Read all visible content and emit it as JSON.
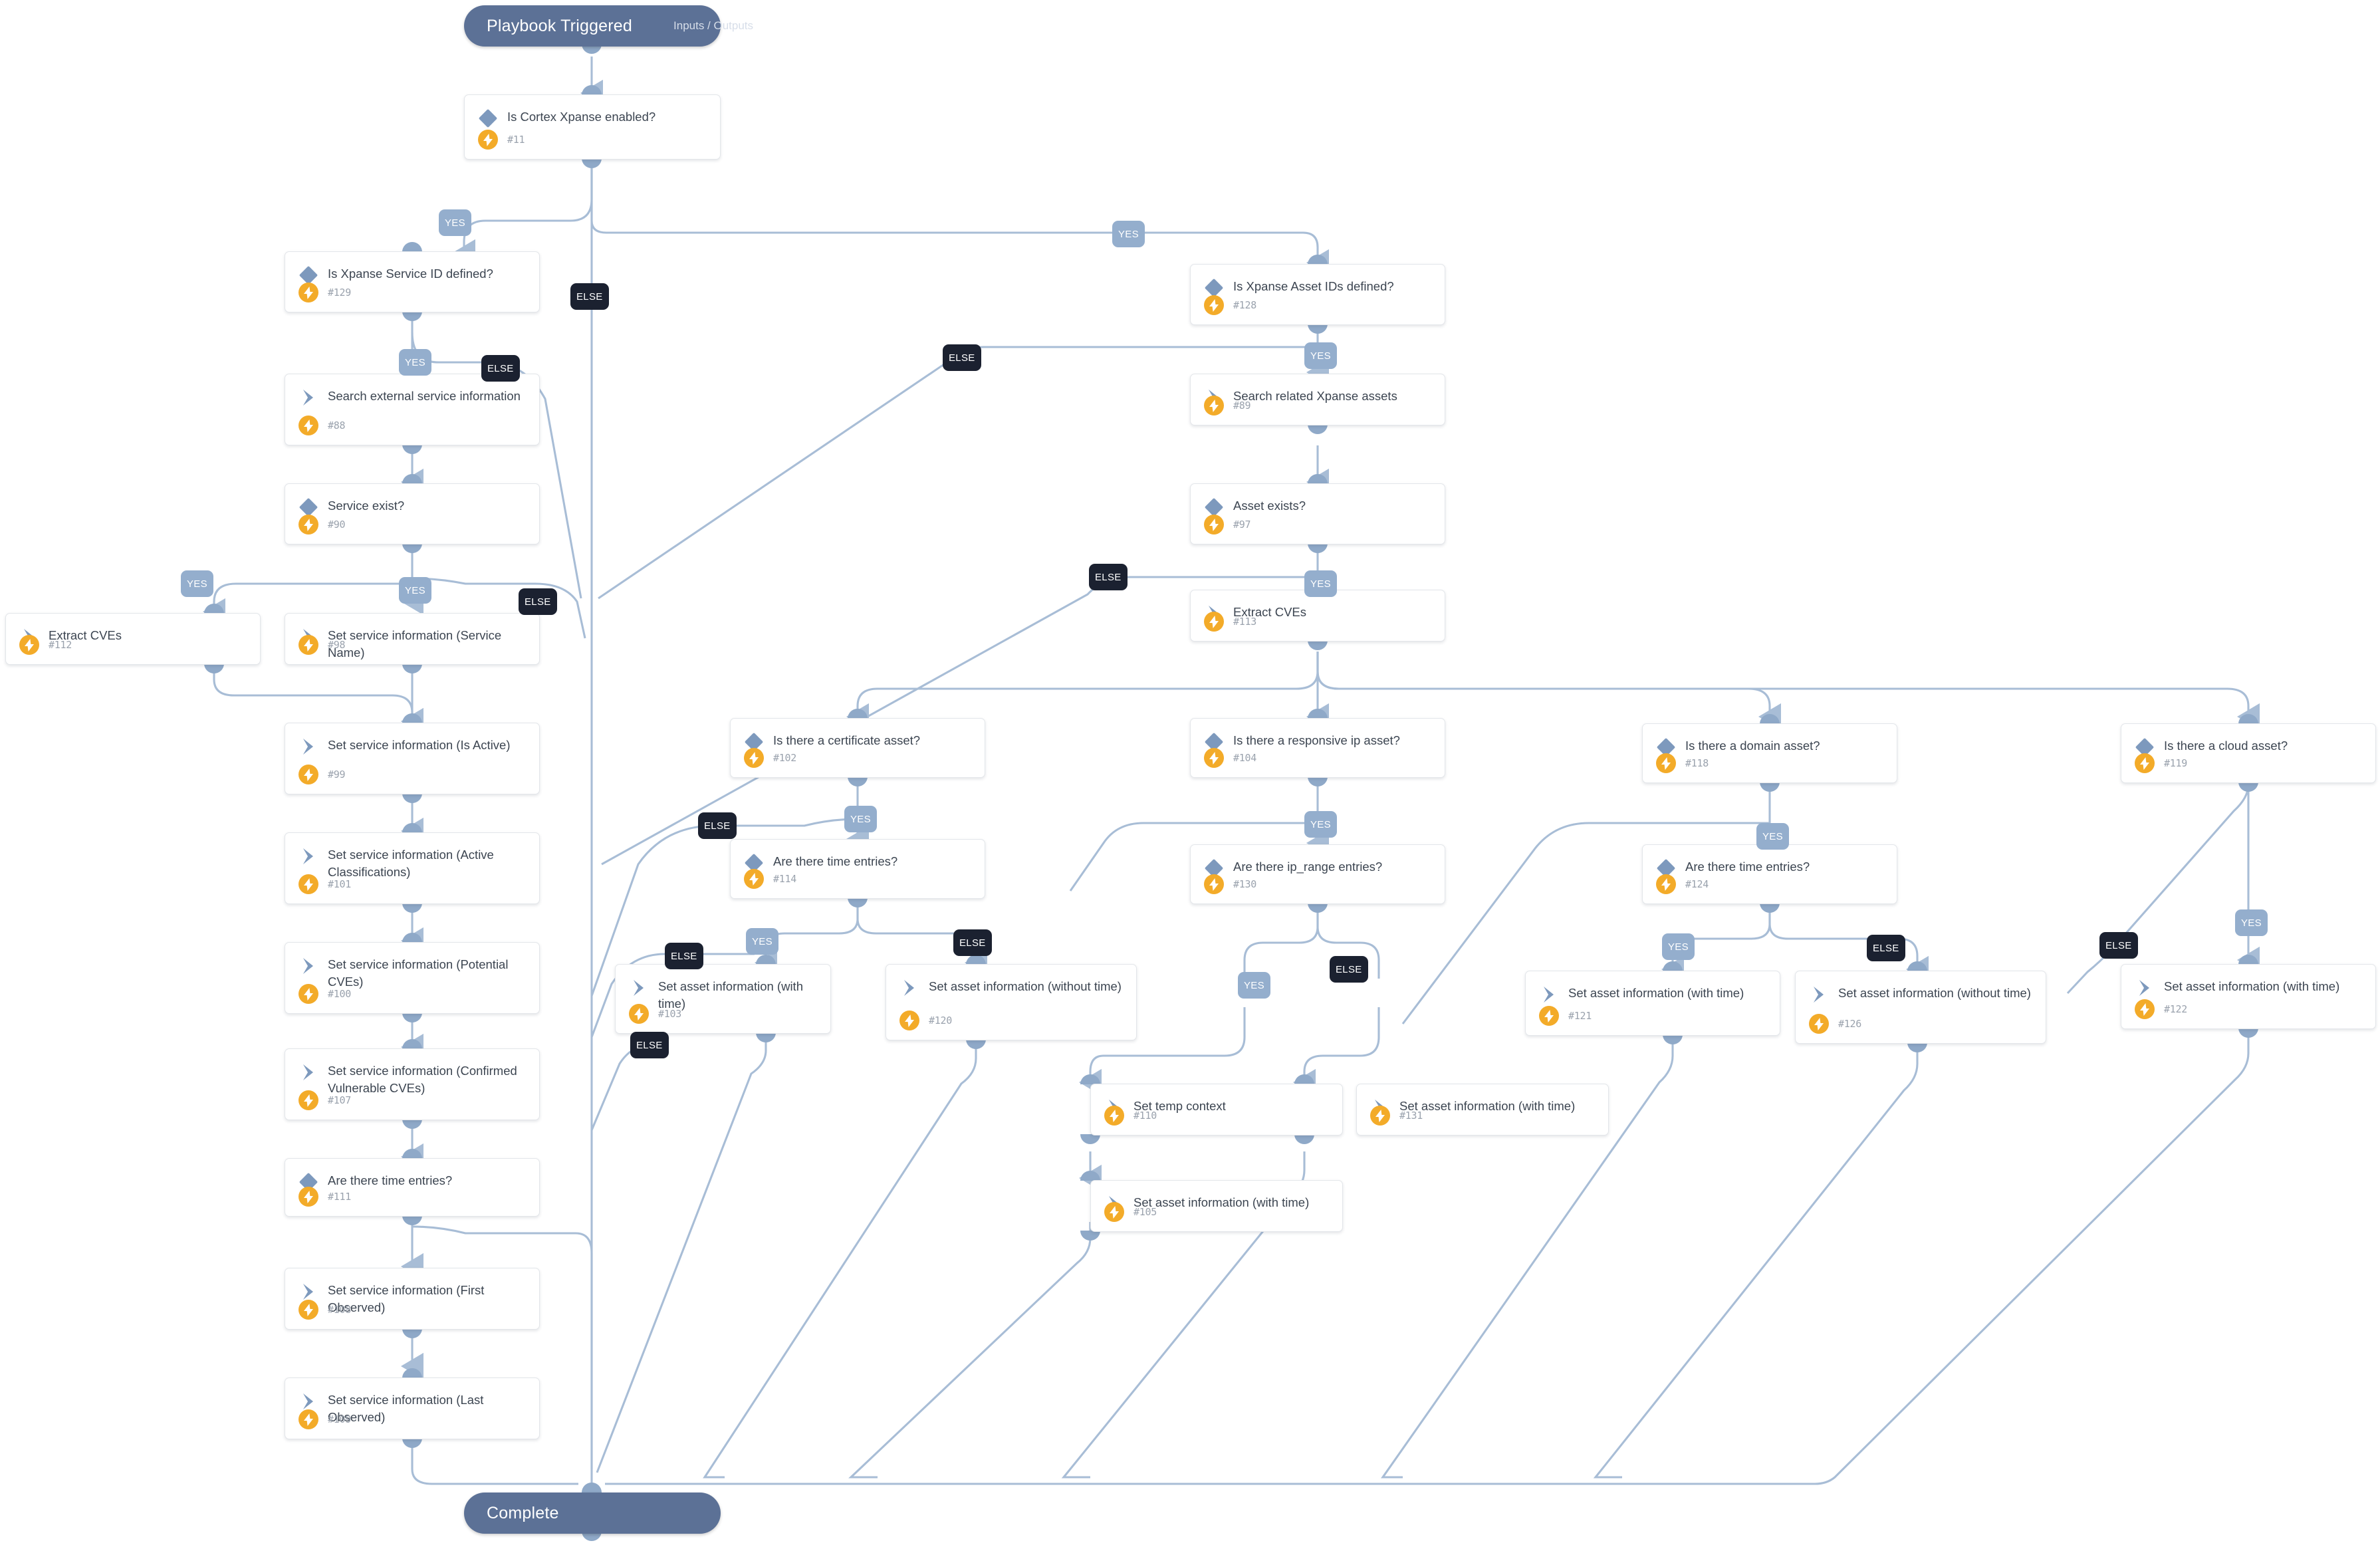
{
  "diagram": {
    "kind": "playbook-flow",
    "start": {
      "label": "Playbook Triggered",
      "sublabel": "Inputs / Outputs"
    },
    "end": {
      "label": "Complete"
    },
    "branch_labels": {
      "yes": "YES",
      "else": "ELSE"
    },
    "colors": {
      "terminal_fill": "#5c7196",
      "node_fill": "#ffffff",
      "node_border": "#e3e6ea",
      "conditional_glyph": "#7d99bd",
      "action_glyph": "#7d99bd",
      "bolt_badge": "#f3ab29",
      "connector": "#a8bdd6",
      "yes_label": "#94aecd",
      "else_label": "#1b2130",
      "title_text": "#3c4551",
      "id_text": "#9aa2ad"
    }
  },
  "nodes": [
    {
      "key": "n11",
      "title": "Is Cortex Xpanse enabled?",
      "id": "#11",
      "type": "conditional"
    },
    {
      "key": "n129",
      "title": "Is Xpanse Service ID defined?",
      "id": "#129",
      "type": "conditional"
    },
    {
      "key": "n88",
      "title": "Search external service information",
      "id": "#88",
      "type": "action"
    },
    {
      "key": "n90",
      "title": "Service exist?",
      "id": "#90",
      "type": "conditional"
    },
    {
      "key": "n112",
      "title": "Extract CVEs",
      "id": "#112",
      "type": "action"
    },
    {
      "key": "n98",
      "title": "Set service information (Service Name)",
      "id": "#98",
      "type": "action"
    },
    {
      "key": "n99",
      "title": "Set service information (Is Active)",
      "id": "#99",
      "type": "action"
    },
    {
      "key": "n101",
      "title": "Set service information (Active Classifications)",
      "id": "#101",
      "type": "action"
    },
    {
      "key": "n100",
      "title": "Set service information (Potential CVEs)",
      "id": "#100",
      "type": "action"
    },
    {
      "key": "n107",
      "title": "Set service information (Confirmed Vulnerable CVEs)",
      "id": "#107",
      "type": "action"
    },
    {
      "key": "n111",
      "title": "Are there time entries?",
      "id": "#111",
      "type": "conditional"
    },
    {
      "key": "n108",
      "title": "Set service information (First Observed)",
      "id": "#108",
      "type": "action"
    },
    {
      "key": "n109",
      "title": "Set service information (Last Observed)",
      "id": "#109",
      "type": "action"
    },
    {
      "key": "n128",
      "title": "Is Xpanse Asset IDs defined?",
      "id": "#128",
      "type": "conditional"
    },
    {
      "key": "n89",
      "title": "Search related Xpanse assets",
      "id": "#89",
      "type": "action"
    },
    {
      "key": "n97",
      "title": "Asset exists?",
      "id": "#97",
      "type": "conditional"
    },
    {
      "key": "n113",
      "title": "Extract CVEs",
      "id": "#113",
      "type": "action"
    },
    {
      "key": "n102",
      "title": "Is there a certificate asset?",
      "id": "#102",
      "type": "conditional"
    },
    {
      "key": "n114",
      "title": "Are there time entries?",
      "id": "#114",
      "type": "conditional"
    },
    {
      "key": "n103",
      "title": "Set asset information (with time)",
      "id": "#103",
      "type": "action"
    },
    {
      "key": "n120",
      "title": "Set asset information (without time)",
      "id": "#120",
      "type": "action"
    },
    {
      "key": "n104",
      "title": "Is there a responsive ip asset?",
      "id": "#104",
      "type": "conditional"
    },
    {
      "key": "n130",
      "title": "Are there ip_range entries?",
      "id": "#130",
      "type": "conditional"
    },
    {
      "key": "n110",
      "title": "Set temp context",
      "id": "#110",
      "type": "action"
    },
    {
      "key": "n131",
      "title": "Set asset information (with time)",
      "id": "#131",
      "type": "action"
    },
    {
      "key": "n105",
      "title": "Set asset information (with time)",
      "id": "#105",
      "type": "action"
    },
    {
      "key": "n118",
      "title": "Is there a domain asset?",
      "id": "#118",
      "type": "conditional"
    },
    {
      "key": "n124",
      "title": "Are there time entries?",
      "id": "#124",
      "type": "conditional"
    },
    {
      "key": "n121",
      "title": "Set asset information (with time)",
      "id": "#121",
      "type": "action"
    },
    {
      "key": "n126",
      "title": "Set asset information (without time)",
      "id": "#126",
      "type": "action"
    },
    {
      "key": "n119",
      "title": "Is there a cloud asset?",
      "id": "#119",
      "type": "conditional"
    },
    {
      "key": "n122",
      "title": "Set asset information (with time)",
      "id": "#122",
      "type": "action"
    }
  ]
}
